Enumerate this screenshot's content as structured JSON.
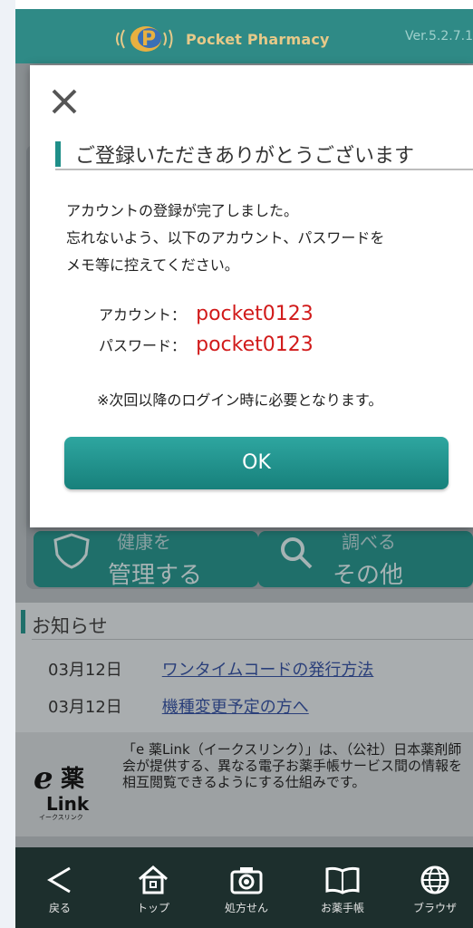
{
  "header": {
    "app_name": "Pocket Pharmacy",
    "version": "Ver.5.2.7.1"
  },
  "background_menu": {
    "health_label": "管理する",
    "health_top": "健康を",
    "other_label": "その他",
    "other_top": "調べる"
  },
  "notice": {
    "title": "お知らせ",
    "items": [
      {
        "date": "03月12日",
        "text": "ワンタイムコードの発行方法"
      },
      {
        "date": "03月12日",
        "text": "機種変更予定の方へ"
      }
    ]
  },
  "elink": {
    "description": "「e 薬Link（イークスリンク）」は、（公社）日本薬剤師会が提供する、異なる電子お薬手帳サービス間の情報を相互閲覧できるようにする仕組みです。"
  },
  "tabbar": {
    "items": [
      {
        "label": "戻る",
        "icon": "back-icon"
      },
      {
        "label": "トップ",
        "icon": "home-icon"
      },
      {
        "label": "処方せん",
        "icon": "camera-icon"
      },
      {
        "label": "お薬手帳",
        "icon": "book-icon"
      },
      {
        "label": "ブラウザ",
        "icon": "globe-icon"
      }
    ]
  },
  "modal": {
    "title": "ご登録いただきありがとうございます",
    "message_lines": [
      "アカウントの登録が完了しました。",
      "忘れないよう、以下のアカウント、パスワードを",
      "メモ等に控えてください。"
    ],
    "account_label": "アカウント：",
    "account_value": "pocket0123",
    "password_label": "パスワード：",
    "password_value": "pocket0123",
    "note": "※次回以降のログイン時に必要となります。",
    "ok_label": "OK"
  },
  "colors": {
    "accent": "#1f8f89",
    "credential": "#d11a1a",
    "header": "#2f8a86"
  }
}
